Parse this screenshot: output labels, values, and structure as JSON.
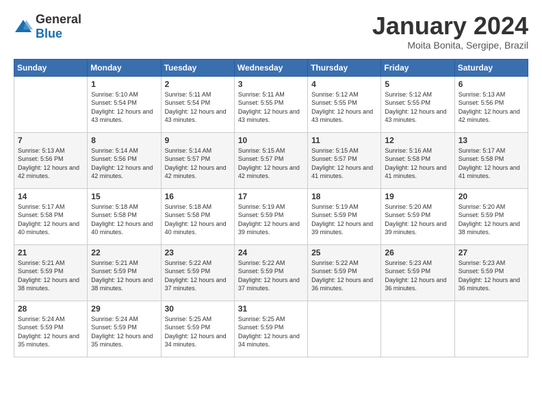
{
  "logo": {
    "general": "General",
    "blue": "Blue"
  },
  "header": {
    "month": "January 2024",
    "location": "Moita Bonita, Sergipe, Brazil"
  },
  "weekdays": [
    "Sunday",
    "Monday",
    "Tuesday",
    "Wednesday",
    "Thursday",
    "Friday",
    "Saturday"
  ],
  "weeks": [
    [
      {
        "day": "",
        "sunrise": "",
        "sunset": "",
        "daylight": ""
      },
      {
        "day": "1",
        "sunrise": "5:10 AM",
        "sunset": "5:54 PM",
        "daylight": "12 hours and 43 minutes."
      },
      {
        "day": "2",
        "sunrise": "5:11 AM",
        "sunset": "5:54 PM",
        "daylight": "12 hours and 43 minutes."
      },
      {
        "day": "3",
        "sunrise": "5:11 AM",
        "sunset": "5:55 PM",
        "daylight": "12 hours and 43 minutes."
      },
      {
        "day": "4",
        "sunrise": "5:12 AM",
        "sunset": "5:55 PM",
        "daylight": "12 hours and 43 minutes."
      },
      {
        "day": "5",
        "sunrise": "5:12 AM",
        "sunset": "5:55 PM",
        "daylight": "12 hours and 43 minutes."
      },
      {
        "day": "6",
        "sunrise": "5:13 AM",
        "sunset": "5:56 PM",
        "daylight": "12 hours and 42 minutes."
      }
    ],
    [
      {
        "day": "7",
        "sunrise": "5:13 AM",
        "sunset": "5:56 PM",
        "daylight": "12 hours and 42 minutes."
      },
      {
        "day": "8",
        "sunrise": "5:14 AM",
        "sunset": "5:56 PM",
        "daylight": "12 hours and 42 minutes."
      },
      {
        "day": "9",
        "sunrise": "5:14 AM",
        "sunset": "5:57 PM",
        "daylight": "12 hours and 42 minutes."
      },
      {
        "day": "10",
        "sunrise": "5:15 AM",
        "sunset": "5:57 PM",
        "daylight": "12 hours and 42 minutes."
      },
      {
        "day": "11",
        "sunrise": "5:15 AM",
        "sunset": "5:57 PM",
        "daylight": "12 hours and 41 minutes."
      },
      {
        "day": "12",
        "sunrise": "5:16 AM",
        "sunset": "5:58 PM",
        "daylight": "12 hours and 41 minutes."
      },
      {
        "day": "13",
        "sunrise": "5:17 AM",
        "sunset": "5:58 PM",
        "daylight": "12 hours and 41 minutes."
      }
    ],
    [
      {
        "day": "14",
        "sunrise": "5:17 AM",
        "sunset": "5:58 PM",
        "daylight": "12 hours and 40 minutes."
      },
      {
        "day": "15",
        "sunrise": "5:18 AM",
        "sunset": "5:58 PM",
        "daylight": "12 hours and 40 minutes."
      },
      {
        "day": "16",
        "sunrise": "5:18 AM",
        "sunset": "5:58 PM",
        "daylight": "12 hours and 40 minutes."
      },
      {
        "day": "17",
        "sunrise": "5:19 AM",
        "sunset": "5:59 PM",
        "daylight": "12 hours and 39 minutes."
      },
      {
        "day": "18",
        "sunrise": "5:19 AM",
        "sunset": "5:59 PM",
        "daylight": "12 hours and 39 minutes."
      },
      {
        "day": "19",
        "sunrise": "5:20 AM",
        "sunset": "5:59 PM",
        "daylight": "12 hours and 39 minutes."
      },
      {
        "day": "20",
        "sunrise": "5:20 AM",
        "sunset": "5:59 PM",
        "daylight": "12 hours and 38 minutes."
      }
    ],
    [
      {
        "day": "21",
        "sunrise": "5:21 AM",
        "sunset": "5:59 PM",
        "daylight": "12 hours and 38 minutes."
      },
      {
        "day": "22",
        "sunrise": "5:21 AM",
        "sunset": "5:59 PM",
        "daylight": "12 hours and 38 minutes."
      },
      {
        "day": "23",
        "sunrise": "5:22 AM",
        "sunset": "5:59 PM",
        "daylight": "12 hours and 37 minutes."
      },
      {
        "day": "24",
        "sunrise": "5:22 AM",
        "sunset": "5:59 PM",
        "daylight": "12 hours and 37 minutes."
      },
      {
        "day": "25",
        "sunrise": "5:22 AM",
        "sunset": "5:59 PM",
        "daylight": "12 hours and 36 minutes."
      },
      {
        "day": "26",
        "sunrise": "5:23 AM",
        "sunset": "5:59 PM",
        "daylight": "12 hours and 36 minutes."
      },
      {
        "day": "27",
        "sunrise": "5:23 AM",
        "sunset": "5:59 PM",
        "daylight": "12 hours and 36 minutes."
      }
    ],
    [
      {
        "day": "28",
        "sunrise": "5:24 AM",
        "sunset": "5:59 PM",
        "daylight": "12 hours and 35 minutes."
      },
      {
        "day": "29",
        "sunrise": "5:24 AM",
        "sunset": "5:59 PM",
        "daylight": "12 hours and 35 minutes."
      },
      {
        "day": "30",
        "sunrise": "5:25 AM",
        "sunset": "5:59 PM",
        "daylight": "12 hours and 34 minutes."
      },
      {
        "day": "31",
        "sunrise": "5:25 AM",
        "sunset": "5:59 PM",
        "daylight": "12 hours and 34 minutes."
      },
      {
        "day": "",
        "sunrise": "",
        "sunset": "",
        "daylight": ""
      },
      {
        "day": "",
        "sunrise": "",
        "sunset": "",
        "daylight": ""
      },
      {
        "day": "",
        "sunrise": "",
        "sunset": "",
        "daylight": ""
      }
    ]
  ],
  "labels": {
    "sunrise": "Sunrise:",
    "sunset": "Sunset:",
    "daylight": "Daylight:"
  }
}
